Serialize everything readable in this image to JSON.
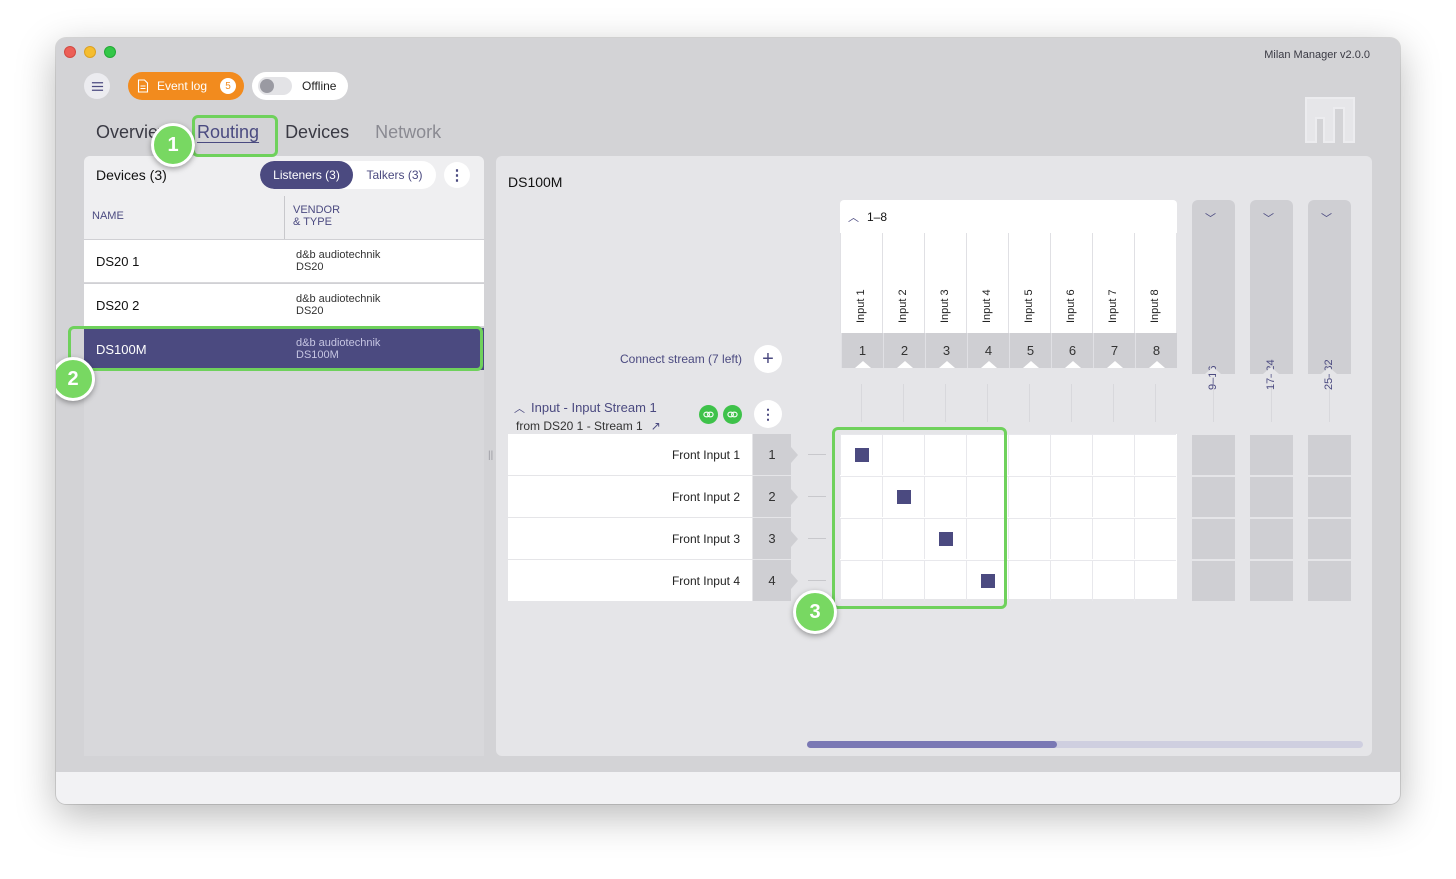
{
  "window": {
    "app_version": "Milan Manager v2.0.0"
  },
  "toolbar": {
    "event_log_label": "Event log",
    "event_log_count": "5",
    "offline_label": "Offline"
  },
  "nav": {
    "tabs": [
      "Overview",
      "Routing",
      "Devices",
      "Network"
    ],
    "active": "Routing"
  },
  "devices_panel": {
    "title": "Devices (3)",
    "segment": {
      "listeners": "Listeners (3)",
      "talkers": "Talkers (3)"
    },
    "columns": {
      "name": "NAME",
      "vendor_line1": "VENDOR",
      "vendor_line2": "& TYPE"
    },
    "rows": [
      {
        "name": "DS20 1",
        "vendor": "d&b audiotechnik",
        "type": "DS20"
      },
      {
        "name": "DS20 2",
        "vendor": "d&b audiotechnik",
        "type": "DS20"
      },
      {
        "name": "DS100M",
        "vendor": "d&b audiotechnik",
        "type": "DS100M",
        "selected": true
      }
    ]
  },
  "routing": {
    "device_title": "DS100M",
    "channel_group": "1–8",
    "channels": [
      {
        "label": "Input 1",
        "num": "1"
      },
      {
        "label": "Input 2",
        "num": "2"
      },
      {
        "label": "Input 3",
        "num": "3"
      },
      {
        "label": "Input 4",
        "num": "4"
      },
      {
        "label": "Input 5",
        "num": "5"
      },
      {
        "label": "Input 6",
        "num": "6"
      },
      {
        "label": "Input 7",
        "num": "7"
      },
      {
        "label": "Input 8",
        "num": "8"
      }
    ],
    "collapsed_groups": [
      "9–16",
      "17–24",
      "25–32"
    ],
    "connect_stream": "Connect stream (7 left)",
    "stream": {
      "title": "Input - Input Stream 1",
      "source": "from DS20 1 - Stream 1"
    },
    "rows": [
      {
        "label": "Front Input 1",
        "num": "1"
      },
      {
        "label": "Front Input 2",
        "num": "2"
      },
      {
        "label": "Front Input 3",
        "num": "3"
      },
      {
        "label": "Front Input 4",
        "num": "4"
      }
    ],
    "connections": [
      [
        0,
        0
      ],
      [
        1,
        1
      ],
      [
        2,
        2
      ],
      [
        3,
        3
      ]
    ],
    "scroll_fraction": 0.45
  },
  "annotations": {
    "badges": [
      "1",
      "2",
      "3"
    ],
    "highlight_color": "#6fd15c"
  },
  "colors": {
    "accent": "#4b4a80",
    "event_log": "#f28b1e",
    "link_green": "#3ec24a"
  }
}
